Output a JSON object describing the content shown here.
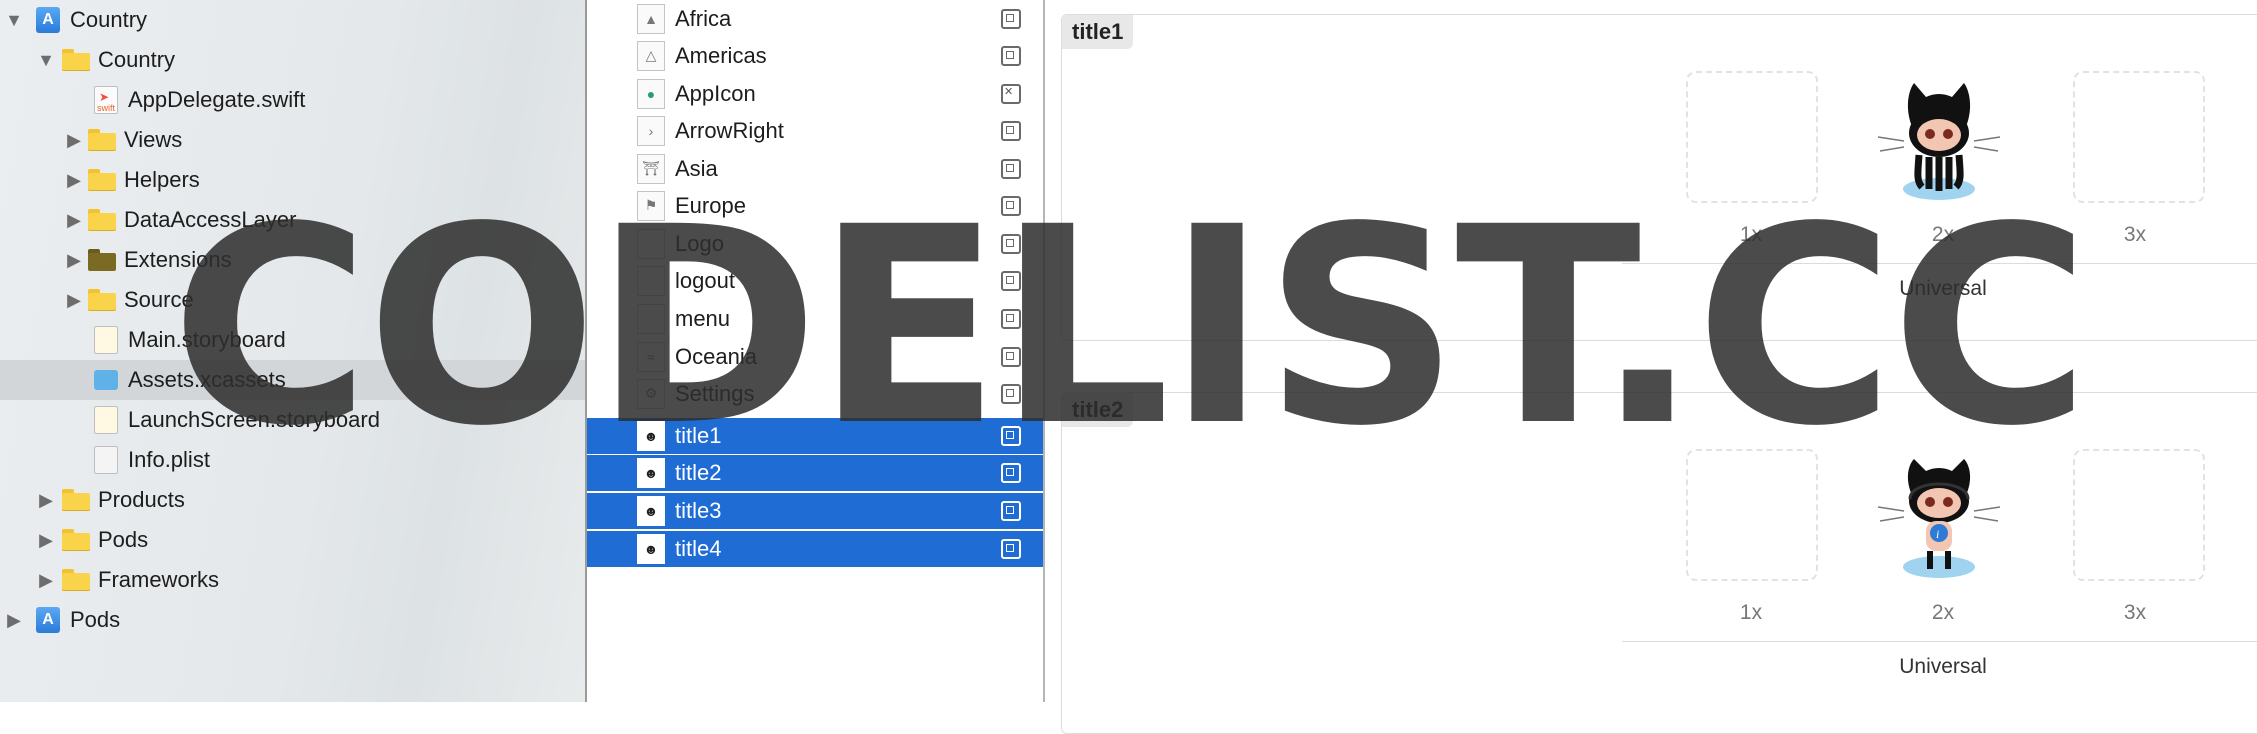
{
  "navigator": {
    "items": [
      {
        "label": "Country",
        "icon": "project-icon",
        "disclosure": "open"
      },
      {
        "label": "Country",
        "icon": "folder-icon",
        "disclosure": "open"
      },
      {
        "label": "AppDelegate.swift",
        "icon": "swift-file-icon",
        "disclosure": ""
      },
      {
        "label": "Views",
        "icon": "folder-icon",
        "disclosure": "closed"
      },
      {
        "label": "Helpers",
        "icon": "folder-icon",
        "disclosure": "closed"
      },
      {
        "label": "DataAccessLayer",
        "icon": "folder-icon",
        "disclosure": "closed"
      },
      {
        "label": "Extensions",
        "icon": "folder-icon",
        "disclosure": "closed"
      },
      {
        "label": "Source",
        "icon": "folder-icon",
        "disclosure": "closed"
      },
      {
        "label": "Main.storyboard",
        "icon": "storyboard-icon",
        "disclosure": ""
      },
      {
        "label": "Assets.xcassets",
        "icon": "xcassets-icon",
        "disclosure": ""
      },
      {
        "label": "LaunchScreen.storyboard",
        "icon": "storyboard-icon",
        "disclosure": ""
      },
      {
        "label": "Info.plist",
        "icon": "plist-icon",
        "disclosure": ""
      },
      {
        "label": "Products",
        "icon": "folder-icon",
        "disclosure": "closed"
      },
      {
        "label": "Pods",
        "icon": "folder-icon",
        "disclosure": "closed"
      },
      {
        "label": "Frameworks",
        "icon": "folder-icon",
        "disclosure": "closed"
      },
      {
        "label": "Pods",
        "icon": "project-icon",
        "disclosure": "closed"
      }
    ]
  },
  "assets": {
    "items": [
      {
        "name": "Africa",
        "selected": false
      },
      {
        "name": "Americas",
        "selected": false
      },
      {
        "name": "AppIcon",
        "selected": false
      },
      {
        "name": "ArrowRight",
        "selected": false
      },
      {
        "name": "Asia",
        "selected": false
      },
      {
        "name": "Europe",
        "selected": false
      },
      {
        "name": "Logo",
        "selected": false
      },
      {
        "name": "logout",
        "selected": false
      },
      {
        "name": "menu",
        "selected": false
      },
      {
        "name": "Oceania",
        "selected": false
      },
      {
        "name": "Settings",
        "selected": false
      },
      {
        "name": "title1",
        "selected": true
      },
      {
        "name": "title2",
        "selected": true
      },
      {
        "name": "title3",
        "selected": true
      },
      {
        "name": "title4",
        "selected": true
      }
    ]
  },
  "editor": {
    "sets": [
      {
        "title": "title1",
        "scales": [
          "1x",
          "2x",
          "3x"
        ],
        "device": "Universal"
      },
      {
        "title": "title2",
        "scales": [
          "1x",
          "2x",
          "3x"
        ],
        "device": "Universal"
      }
    ]
  },
  "watermark": "CODELIST.CC",
  "colors": {
    "selection": "#1f6cd4",
    "folder": "#f9d349"
  }
}
